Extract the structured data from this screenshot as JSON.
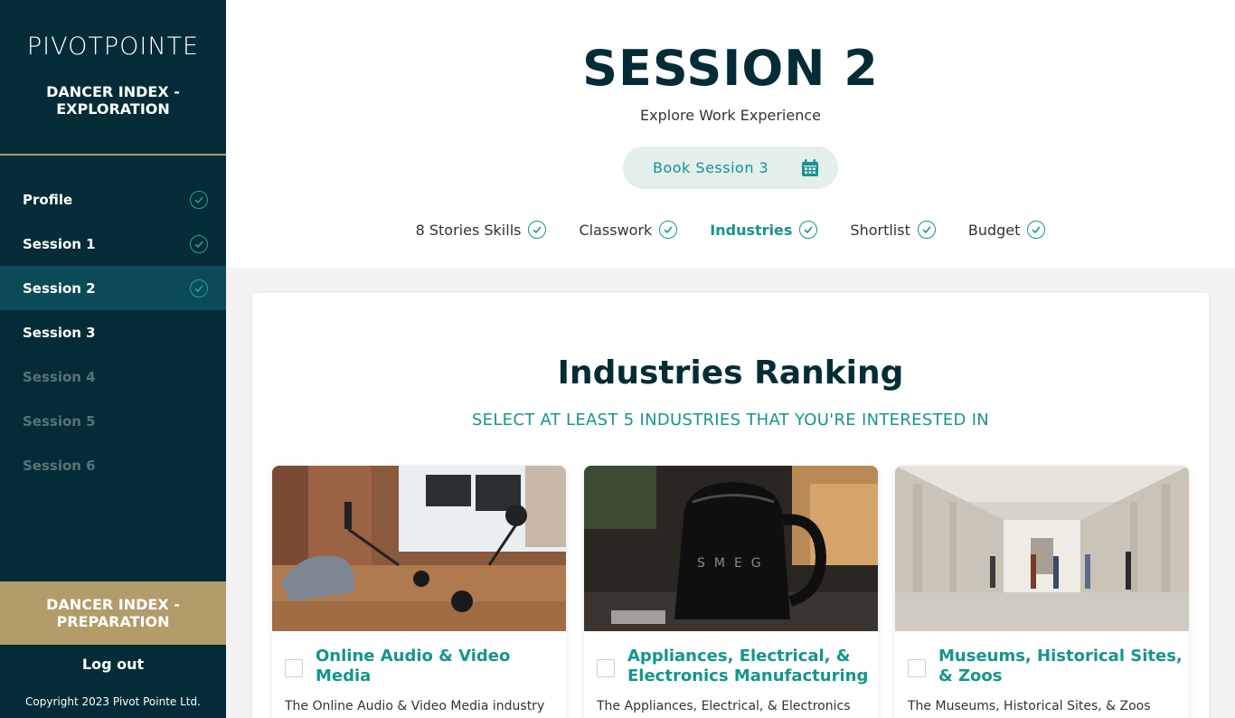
{
  "sidebar": {
    "logo": "PIVOTPOINTE",
    "program": "DANCER INDEX - EXPLORATION",
    "items": [
      {
        "label": "Profile",
        "state": "done"
      },
      {
        "label": "Session 1",
        "state": "done"
      },
      {
        "label": "Session 2",
        "state": "active"
      },
      {
        "label": "Session 3",
        "state": "open"
      },
      {
        "label": "Session 4",
        "state": "disabled"
      },
      {
        "label": "Session 5",
        "state": "disabled"
      },
      {
        "label": "Session 6",
        "state": "disabled"
      }
    ],
    "preparation": "DANCER INDEX - PREPARATION",
    "logout": "Log out",
    "copyright": "Copyright 2023 Pivot Pointe Ltd."
  },
  "header": {
    "title": "SESSION 2",
    "subtitle": "Explore Work Experience",
    "book_button": "Book Session 3",
    "tabs": [
      {
        "label": "8 Stories Skills",
        "active": false
      },
      {
        "label": "Classwork",
        "active": false
      },
      {
        "label": "Industries",
        "active": true
      },
      {
        "label": "Shortlist",
        "active": false
      },
      {
        "label": "Budget",
        "active": false
      }
    ]
  },
  "main": {
    "title": "Industries Ranking",
    "subtitle": "SELECT AT LEAST 5 INDUSTRIES THAT YOU'RE INTERESTED IN",
    "industries": [
      {
        "name": "Online Audio & Video Media",
        "desc": "The Online Audio & Video Media industry"
      },
      {
        "name": "Appliances, Electrical, & Electronics Manufacturing",
        "desc": "The Appliances, Electrical, & Electronics"
      },
      {
        "name": "Museums, Historical Sites, & Zoos",
        "desc": "The Museums, Historical Sites, & Zoos"
      }
    ]
  },
  "colors": {
    "sidebar_bg": "#032c36",
    "active_item": "#0b4a57",
    "gold": "#b39b6a",
    "teal": "#15958d"
  }
}
